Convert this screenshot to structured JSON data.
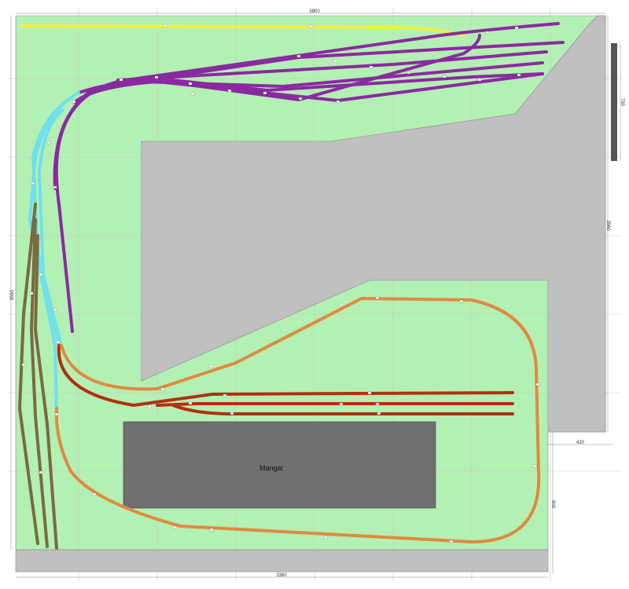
{
  "dimensions": {
    "top_width": "3800",
    "bottom_width": "3380",
    "left_height": "3550",
    "right_height": "3560",
    "window_width": "750",
    "corner_width": "420",
    "corner_height": "900"
  },
  "labels": {
    "pit": "Mangat"
  },
  "colors": {
    "background": "#ffffff",
    "board": "#b3f0b3",
    "grid": "#c8c8c8",
    "floor_gray": "#c0c0c0",
    "pit_gray": "#707070",
    "window_dark": "#555555",
    "track_yellow": "#f0f040",
    "track_purple": "#8a2aa0",
    "track_cyan": "#6fe0ec",
    "track_brown": "#7a6a40",
    "track_red": "#b03010",
    "track_orange": "#e08a40"
  }
}
